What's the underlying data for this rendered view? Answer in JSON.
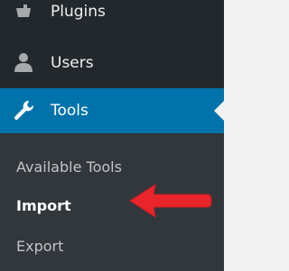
{
  "sidebar": {
    "items": [
      {
        "label": "Plugins",
        "icon": "plugin-icon"
      },
      {
        "label": "Users",
        "icon": "users-icon"
      },
      {
        "label": "Tools",
        "icon": "wrench-icon",
        "active": true
      }
    ],
    "submenu": [
      {
        "label": "Available Tools"
      },
      {
        "label": "Import",
        "current": true
      },
      {
        "label": "Export"
      }
    ]
  },
  "colors": {
    "sidebar_bg": "#23282d",
    "submenu_bg": "#32373c",
    "active_bg": "#0073aa",
    "arrow": "#e8252b"
  },
  "annotation": {
    "icon": "red-arrow-icon"
  }
}
